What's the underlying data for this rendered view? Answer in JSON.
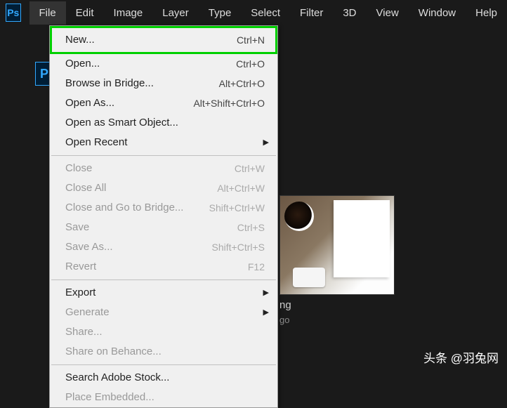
{
  "app": {
    "logo_text": "Ps"
  },
  "menubar": {
    "items": [
      {
        "label": "File"
      },
      {
        "label": "Edit"
      },
      {
        "label": "Image"
      },
      {
        "label": "Layer"
      },
      {
        "label": "Type"
      },
      {
        "label": "Select"
      },
      {
        "label": "Filter"
      },
      {
        "label": "3D"
      },
      {
        "label": "View"
      },
      {
        "label": "Window"
      },
      {
        "label": "Help"
      }
    ]
  },
  "file_menu": {
    "groups": [
      [
        {
          "label": "New...",
          "shortcut": "Ctrl+N",
          "highlighted": true
        },
        {
          "label": "Open...",
          "shortcut": "Ctrl+O"
        },
        {
          "label": "Browse in Bridge...",
          "shortcut": "Alt+Ctrl+O"
        },
        {
          "label": "Open As...",
          "shortcut": "Alt+Shift+Ctrl+O"
        },
        {
          "label": "Open as Smart Object..."
        },
        {
          "label": "Open Recent",
          "submenu": true
        }
      ],
      [
        {
          "label": "Close",
          "shortcut": "Ctrl+W",
          "disabled": true
        },
        {
          "label": "Close All",
          "shortcut": "Alt+Ctrl+W",
          "disabled": true
        },
        {
          "label": "Close and Go to Bridge...",
          "shortcut": "Shift+Ctrl+W",
          "disabled": true
        },
        {
          "label": "Save",
          "shortcut": "Ctrl+S",
          "disabled": true
        },
        {
          "label": "Save As...",
          "shortcut": "Shift+Ctrl+S",
          "disabled": true
        },
        {
          "label": "Revert",
          "shortcut": "F12",
          "disabled": true
        }
      ],
      [
        {
          "label": "Export",
          "submenu": true
        },
        {
          "label": "Generate",
          "submenu": true,
          "disabled": true
        },
        {
          "label": "Share...",
          "disabled": true
        },
        {
          "label": "Share on Behance...",
          "disabled": true
        }
      ],
      [
        {
          "label": "Search Adobe Stock..."
        },
        {
          "label": "Place Embedded...",
          "disabled": true
        }
      ]
    ]
  },
  "thumbnail": {
    "title_suffix": "ng",
    "time_suffix": "go"
  },
  "watermark": {
    "icon_text": "头条",
    "text": "头条 @羽兔网"
  }
}
